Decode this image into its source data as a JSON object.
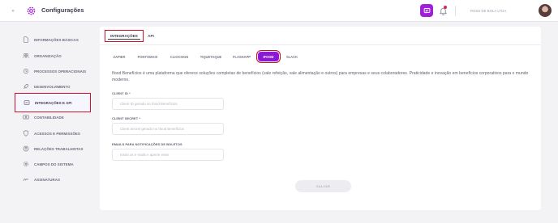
{
  "header": {
    "title": "Configurações",
    "company": "ROSS DE BOLA LTDA."
  },
  "sidebar": {
    "items": [
      {
        "label": "INFORMAÇÕES BÁSICAS",
        "icon": "file-icon"
      },
      {
        "label": "ORGANIZAÇÃO",
        "icon": "people-icon"
      },
      {
        "label": "PROCESSOS OPERACIONAIS",
        "icon": "process-icon"
      },
      {
        "label": "DESENVOLVIMENTO",
        "icon": "rocket-icon"
      },
      {
        "label": "INTEGRAÇÕES E API",
        "icon": "api-icon"
      },
      {
        "label": "CONTABILIDADE",
        "icon": "dollar-icon"
      },
      {
        "label": "ACESSOS E PERMISSÕES",
        "icon": "shield-icon"
      },
      {
        "label": "RELAÇÕES TRABALHISTAS",
        "icon": "badge-icon"
      },
      {
        "label": "CAMPOS DO SISTEMA",
        "icon": "settings-icon"
      },
      {
        "label": "ASSINATURAS",
        "icon": "signature-icon"
      }
    ]
  },
  "tabs": [
    "INTEGRAÇÕES",
    "API"
  ],
  "subtabs": [
    "ZAPIER",
    "PONTOMAIS",
    "CLICKSIGN",
    "TIQUETAQUE",
    "FLASHAPP",
    "IFOOD",
    "SLACK"
  ],
  "content": {
    "description": "Ifood Benefícios é uma plataforma que oferece soluções completas de benefícios (vale refeição, vale alimentação e outros) para empresas e seus colaboradores. Praticidade e inovação em benefícios corporativos para o mundo moderno.",
    "fields": [
      {
        "label": "CLIENT ID *",
        "placeholder": "Client ID gerado no Ifood Benefícios"
      },
      {
        "label": "CLIENT SECRET *",
        "placeholder": "Client Secret gerado no Ifood Benefícios"
      },
      {
        "label": "EMAILS PARA NOTIFICAÇÕES DE BOLETOS",
        "placeholder": "Insira os e-mails e aperte enter"
      }
    ],
    "save_label": "SALVAR"
  },
  "colors": {
    "accent": "#8a19d6",
    "highlight_border": "#d0112b"
  }
}
